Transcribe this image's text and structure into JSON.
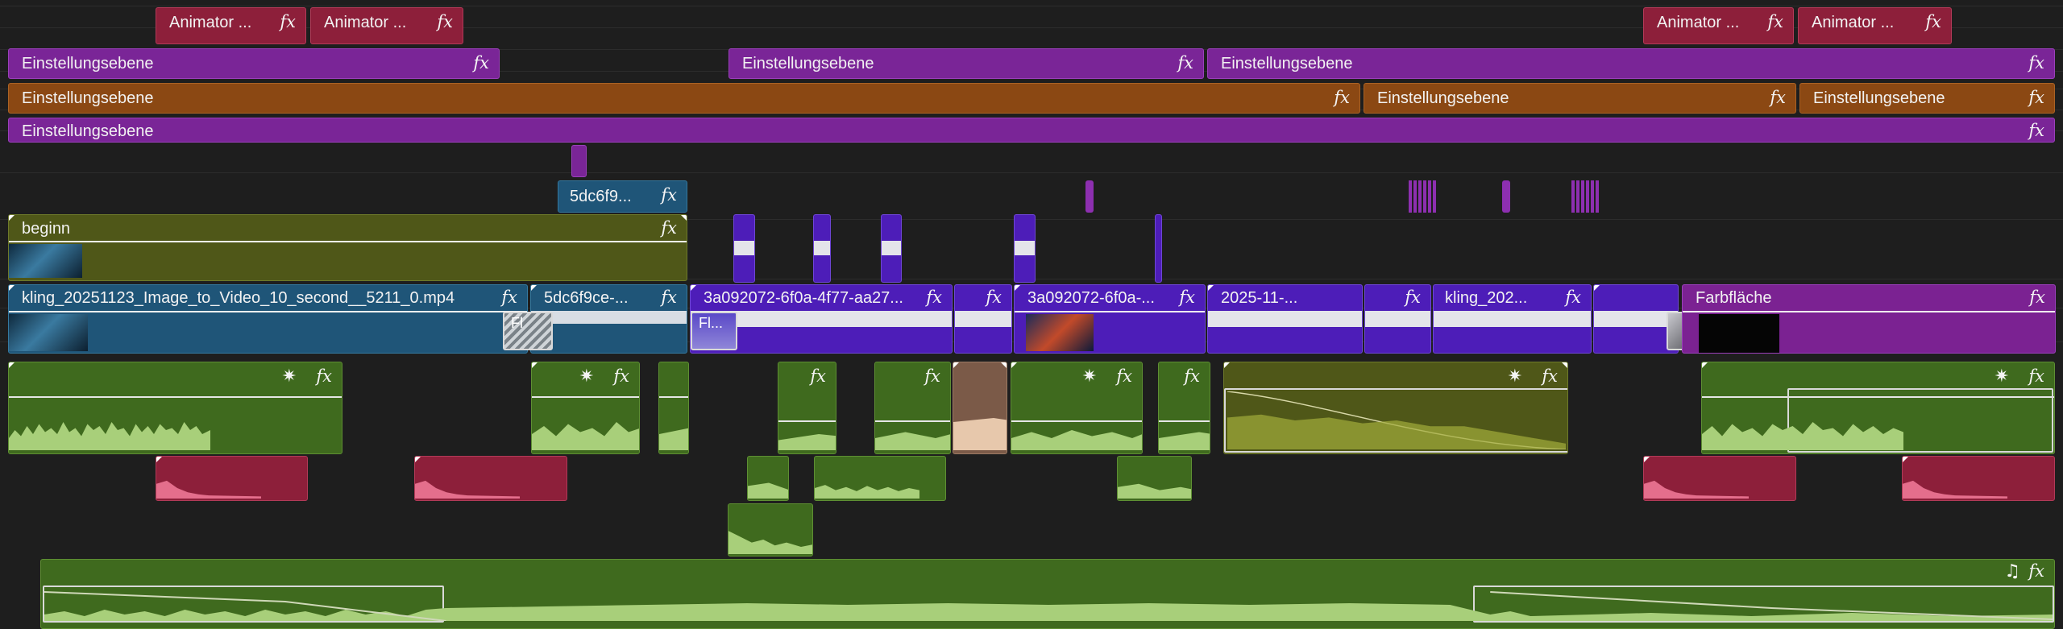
{
  "labels": {
    "animator": "Animator ...",
    "adjustment": "Einstellungsebene",
    "begin": "beginn",
    "clip_kling_long": "kling_20251123_Image_to_Video_10_second__5211_0.mp4",
    "clip_5dc_short": "5dc6f9...",
    "clip_5dc_long": "5dc6f9ce-...",
    "clip_3a_long": "3a092072-6f0a-4f77-aa27...",
    "clip_3a_short": "3a092072-6f0a-...",
    "clip_2025": "2025-11-...",
    "clip_kling_short": "kling_202...",
    "color_matte": "Farbfläche",
    "fl": "Fl",
    "fl2": "Fl..."
  },
  "glyphs": {
    "fx": "fx",
    "star": "✷",
    "music_note": "♫"
  },
  "colors": {
    "background": "#1e1e1e",
    "animator_clip": "#8d1f3a",
    "adjustment_purple": "#7a2597",
    "adjustment_orange": "#8b4813",
    "video_olive": "#4f5718",
    "video_teal": "#1f5578",
    "video_violet": "#4d1db8",
    "audio_green": "#3f6a1e",
    "audio_pink": "#8d1f3a"
  }
}
